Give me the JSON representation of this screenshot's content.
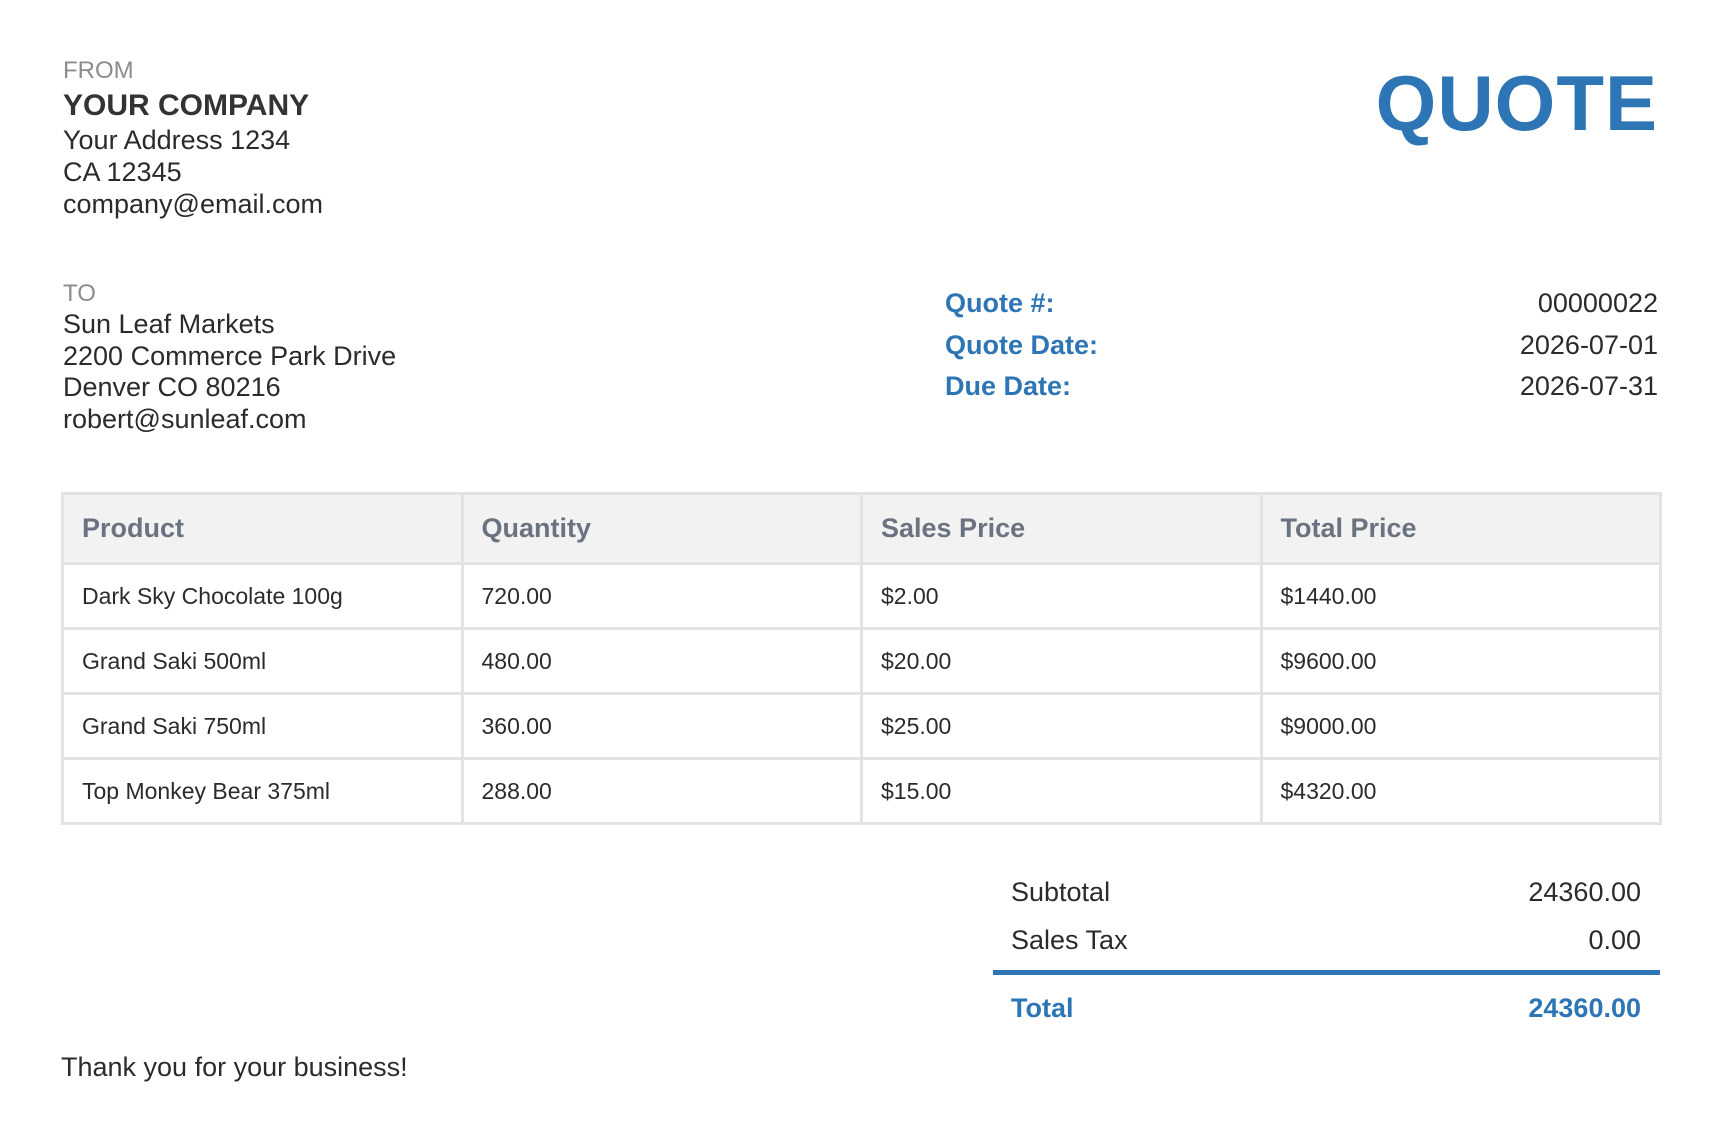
{
  "document": {
    "title": "QUOTE"
  },
  "from": {
    "label": "FROM",
    "company": "YOUR COMPANY",
    "address_line1": "Your Address 1234",
    "address_line2": "CA 12345",
    "email": "company@email.com"
  },
  "to": {
    "label": "TO",
    "name": "Sun Leaf Markets",
    "address_line1": "2200 Commerce Park Drive",
    "address_line2": "Denver CO 80216",
    "email": "robert@sunleaf.com"
  },
  "meta": [
    {
      "label": "Quote #:",
      "value": "00000022"
    },
    {
      "label": "Quote Date:",
      "value": "2026-07-01"
    },
    {
      "label": "Due Date:",
      "value": "2026-07-31"
    }
  ],
  "table": {
    "headers": [
      "Product",
      "Quantity",
      "Sales Price",
      "Total Price"
    ],
    "rows": [
      [
        "Dark Sky Chocolate 100g",
        "720.00",
        "$2.00",
        "$1440.00"
      ],
      [
        "Grand Saki 500ml",
        "480.00",
        "$20.00",
        "$9600.00"
      ],
      [
        "Grand Saki 750ml",
        "360.00",
        "$25.00",
        "$9000.00"
      ],
      [
        "Top Monkey Bear 375ml",
        "288.00",
        "$15.00",
        "$4320.00"
      ]
    ]
  },
  "totals": {
    "subtotal_label": "Subtotal",
    "subtotal_value": "24360.00",
    "tax_label": "Sales Tax",
    "tax_value": "0.00",
    "total_label": "Total",
    "total_value": "24360.00"
  },
  "footer": {
    "thanks": "Thank you for your business!"
  },
  "colors": {
    "accent": "#2e75b6",
    "header_bg": "#f2f2f2",
    "border": "#e3e3e3",
    "muted": "#8c8c8c"
  }
}
